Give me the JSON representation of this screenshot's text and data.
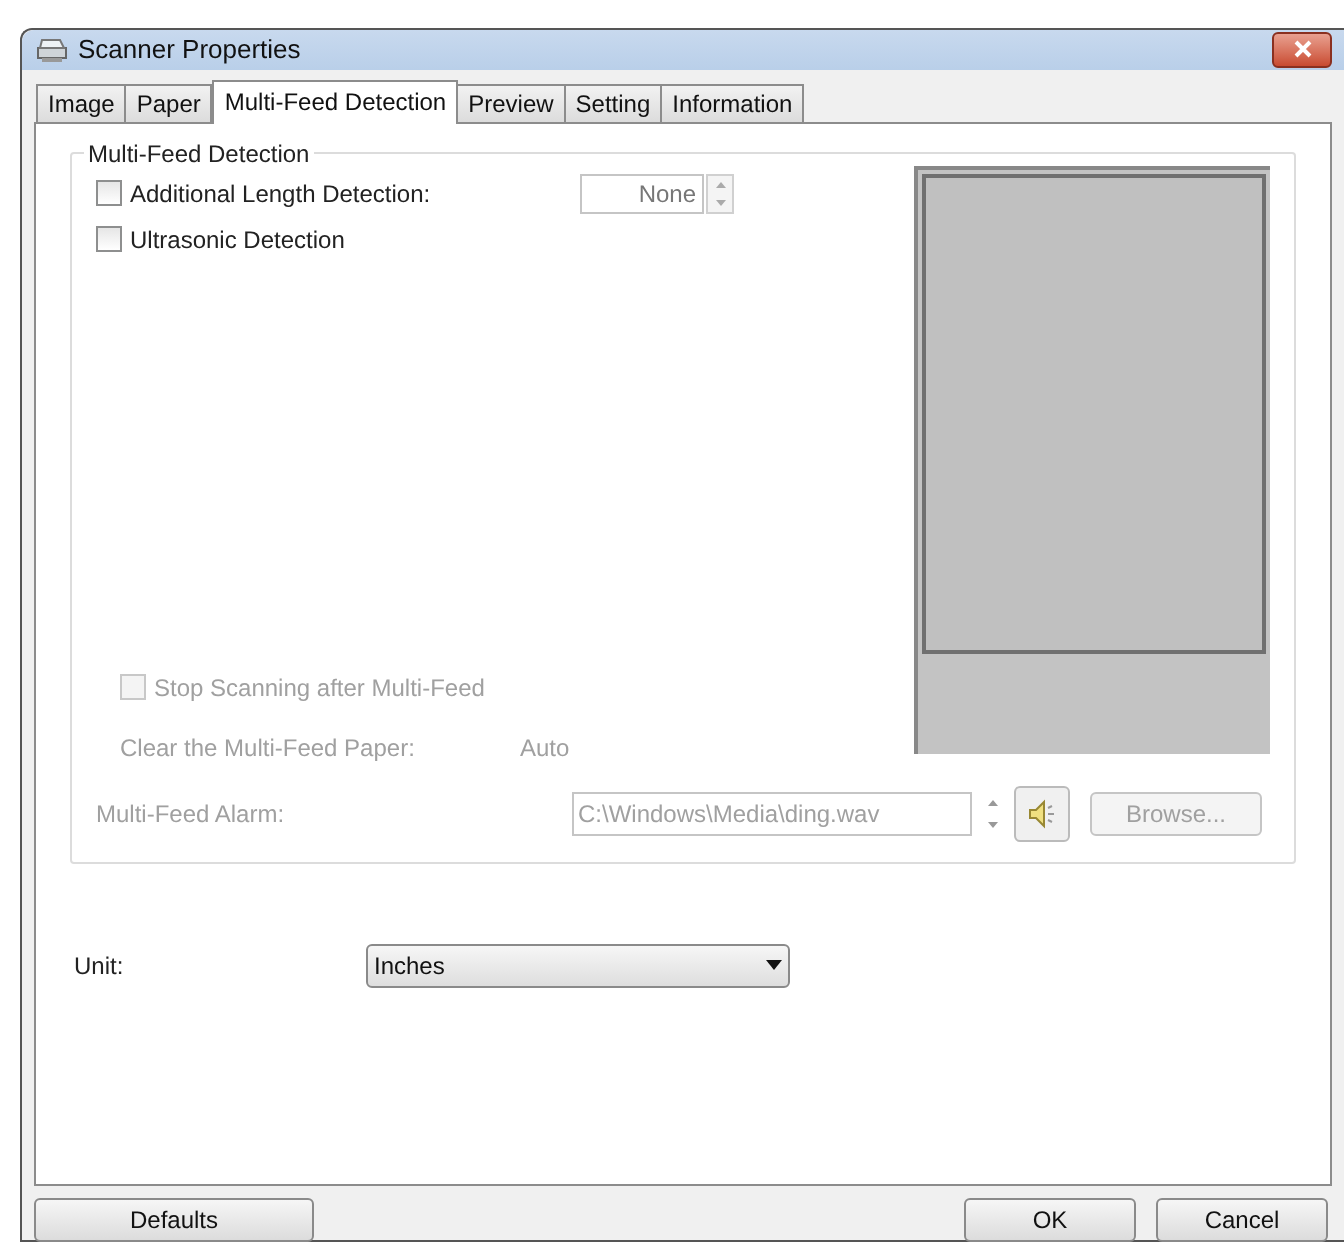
{
  "window": {
    "title": "Scanner Properties"
  },
  "tabs": [
    {
      "label": "Image",
      "selected": false
    },
    {
      "label": "Paper",
      "selected": false
    },
    {
      "label": "Multi-Feed Detection",
      "selected": true
    },
    {
      "label": "Preview",
      "selected": false
    },
    {
      "label": "Setting",
      "selected": false
    },
    {
      "label": "Information",
      "selected": false
    }
  ],
  "group": {
    "title": "Multi-Feed Detection",
    "length_detection": {
      "label": "Additional Length Detection:",
      "checked": false,
      "value": "None"
    },
    "ultrasonic": {
      "label": "Ultrasonic Detection",
      "checked": false
    },
    "stop_scanning": {
      "label": "Stop Scanning after Multi-Feed",
      "checked": false,
      "disabled": true
    },
    "clear_paper": {
      "label": "Clear the Multi-Feed Paper:",
      "value": "Auto",
      "disabled": true
    },
    "alarm": {
      "label": "Multi-Feed Alarm:",
      "value": "C:\\Windows\\Media\\ding.wav",
      "browse": "Browse...",
      "disabled": true
    }
  },
  "unit": {
    "label": "Unit:",
    "value": "Inches"
  },
  "buttons": {
    "defaults": "Defaults",
    "ok": "OK",
    "cancel": "Cancel"
  }
}
